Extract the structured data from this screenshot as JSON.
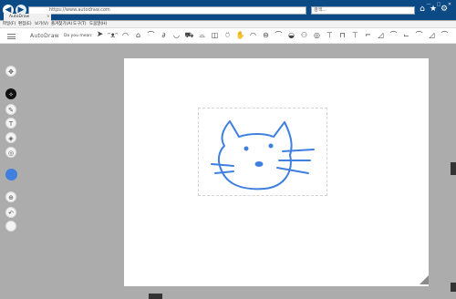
{
  "browser": {
    "address_url": "https://www.autodraw.com",
    "search_placeholder": "검색...",
    "tab_title": "AutoDraw",
    "tab_close": "×",
    "back_icon": "back-arrow-icon",
    "forward_icon": "forward-arrow-icon"
  },
  "menubar": {
    "items": [
      "파일(F)",
      "편집(E)",
      "보기(V)",
      "즐겨찾기(A)",
      "도구(T)",
      "도움말(H)"
    ]
  },
  "app": {
    "brand": "AutoDraw",
    "did_you_mean": "Do you mean:",
    "suggestions": [
      "cat-face-icon",
      "cat-face-icon",
      "bicycle-icon",
      "cat-icon",
      "fish-icon",
      "shoe-icon",
      "car-icon",
      "tractor-icon",
      "skate-icon",
      "mouse-icon",
      "hand-icon",
      "owl-icon",
      "ufo-icon",
      "mask-icon",
      "bus-icon",
      "face-icon",
      "lamp-icon",
      "truck-icon",
      "shoe-icon",
      "boot-icon",
      "sneaker-icon",
      "pump-icon"
    ]
  },
  "tools": {
    "items": [
      "move-icon",
      "autodraw-icon",
      "draw-icon",
      "type-icon",
      "fill-icon",
      "shape-icon",
      "color-icon",
      "zoom-icon",
      "undo-icon",
      "delete-icon"
    ],
    "active": "autodraw-icon",
    "color": "#3f7fe0"
  }
}
